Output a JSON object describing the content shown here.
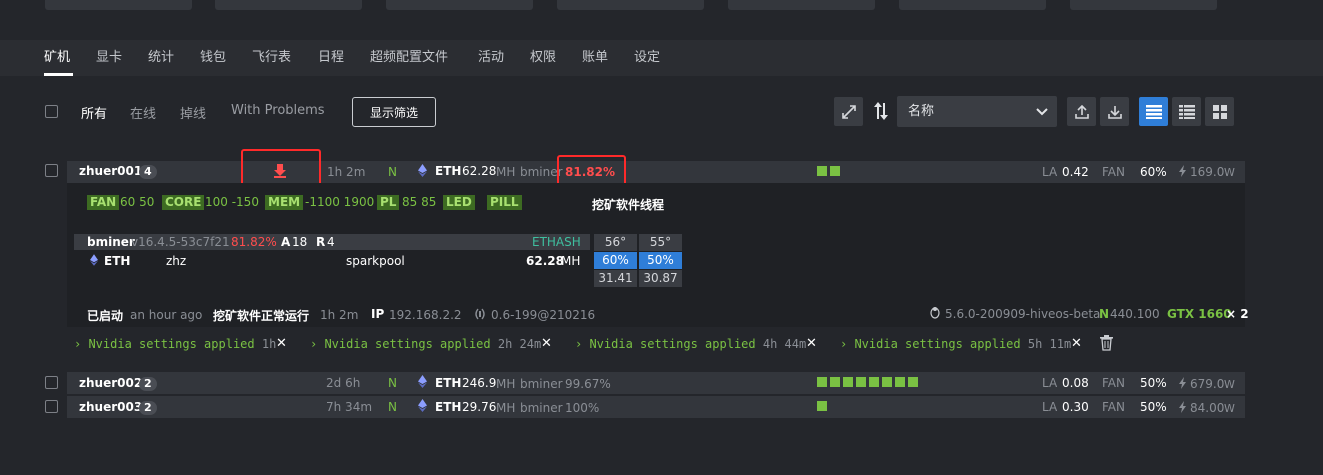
{
  "tabs": [
    "矿机",
    "显卡",
    "统计",
    "钱包",
    "飞行表",
    "日程",
    "超频配置文件",
    "活动",
    "权限",
    "账单",
    "设定"
  ],
  "filters": [
    "所有",
    "在线",
    "掉线",
    "With Problems"
  ],
  "filter_button": "显示筛选",
  "sort_select": "名称",
  "workers": [
    {
      "name": "zhuer001",
      "count": "4",
      "uptime": "1h 2m",
      "tag": "N",
      "coin": "ETH",
      "hash": "62.28",
      "unit": "MH",
      "miner": "bminer",
      "pct": "81.82%",
      "la_label": "LA",
      "la": "0.42",
      "fan_label": "FAN",
      "fan": "60%",
      "power": "169.0",
      "power_unit": "W",
      "gpu_bars": 2
    },
    {
      "name": "zhuer002",
      "count": "2",
      "uptime": "2d 6h",
      "tag": "N",
      "coin": "ETH",
      "hash": "246.9",
      "unit": "MH",
      "miner": "bminer",
      "pct": "99.67%",
      "la_label": "LA",
      "la": "0.08",
      "fan_label": "FAN",
      "fan": "50%",
      "power": "679.0",
      "power_unit": "W",
      "gpu_bars": 8
    },
    {
      "name": "zhuer003",
      "count": "2",
      "uptime": "7h 34m",
      "tag": "N",
      "coin": "ETH",
      "hash": "29.76",
      "unit": "MH",
      "miner": "bminer",
      "pct": "100%",
      "la_label": "LA",
      "la": "0.30",
      "fan_label": "FAN",
      "fan": "50%",
      "power": "84.00",
      "power_unit": "W",
      "gpu_bars": 1
    }
  ],
  "oc": {
    "fan_label": "FAN",
    "fan": "60 50",
    "core_label": "CORE",
    "core": "100 -150",
    "mem_label": "MEM",
    "mem": "-1100 1900",
    "pl_label": "PL",
    "pl": "85 85",
    "led_label": "LED",
    "pill_label": "PILL",
    "threads_title": "挖矿软件线程"
  },
  "miner": {
    "name": "bminer",
    "version": "v16.4.5-53c7f21",
    "pct": "81.82%",
    "a_label": "A",
    "a": "18",
    "r_label": "R",
    "r": "4",
    "algo": "ETHASH",
    "coin": "ETH",
    "wallet": "zhz",
    "pool": "sparkpool",
    "hash": "62.28",
    "unit": "MH"
  },
  "gpus": [
    {
      "temp": "56°",
      "fan": "60%",
      "hash": "31.41"
    },
    {
      "temp": "55°",
      "fan": "50%",
      "hash": "30.87"
    }
  ],
  "status": {
    "started_label": "已启动",
    "started": "an hour ago",
    "running_label": "挖矿软件正常运行",
    "running": "1h 2m",
    "ip_label": "IP",
    "ip": "192.168.2.2",
    "version": "0.6-199@210216",
    "os": "5.6.0-200909-hiveos-beta",
    "driver_label": "N",
    "driver": "440.100",
    "gpu_model": "GTX 1660",
    "gpu_count": "× 2"
  },
  "notifications": [
    {
      "text": "Nvidia settings applied",
      "time": "1h"
    },
    {
      "text": "Nvidia settings applied",
      "time": "2h 24m"
    },
    {
      "text": "Nvidia settings applied",
      "time": "4h 44m"
    },
    {
      "text": "Nvidia settings applied",
      "time": "5h 11m"
    }
  ],
  "colors": {
    "accent": "#2f7ed8",
    "green": "#7ac143",
    "red": "#ff4d4d"
  }
}
